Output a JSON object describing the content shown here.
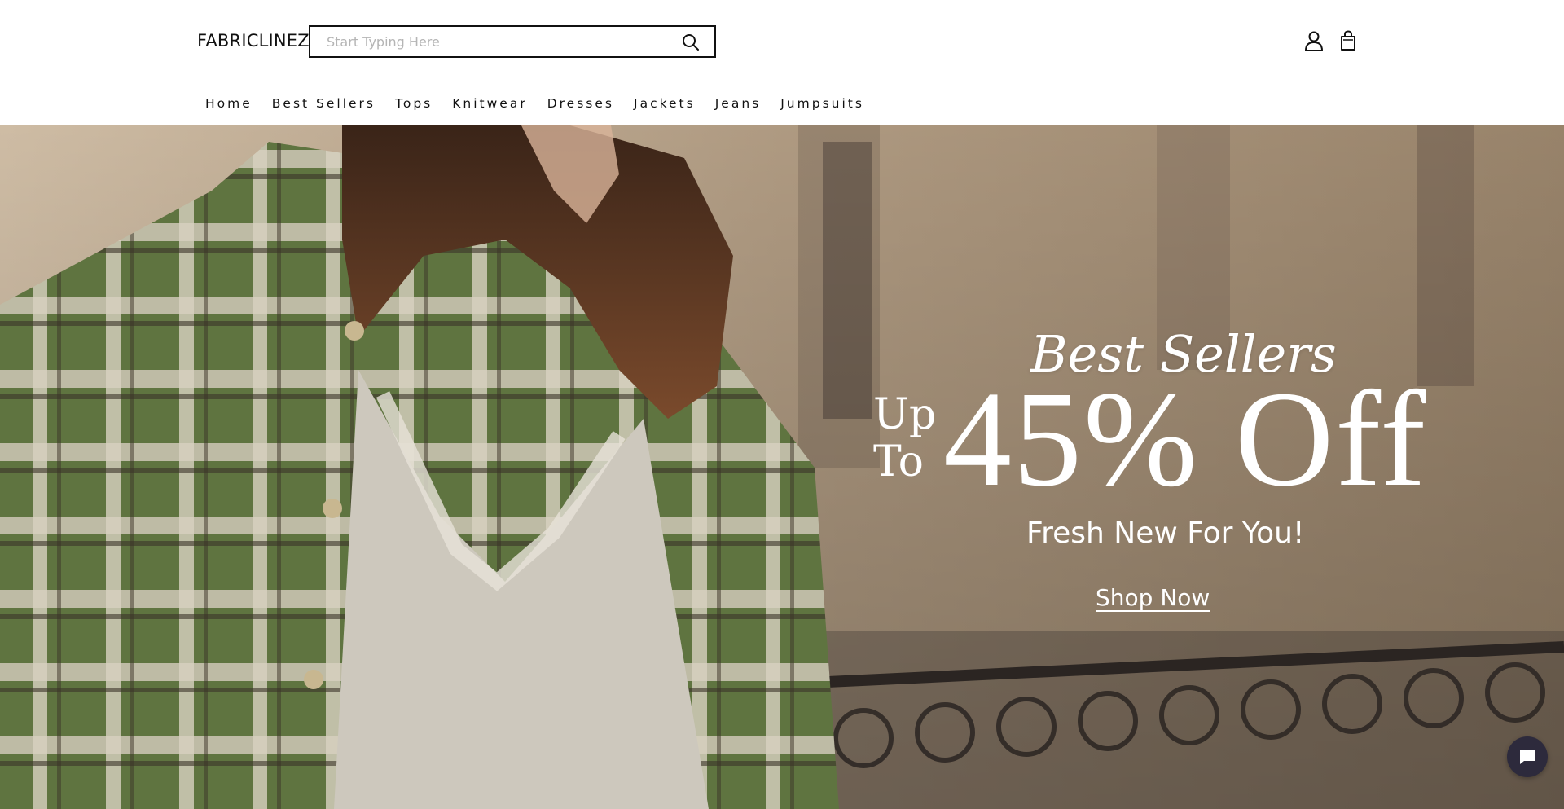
{
  "header": {
    "logo": "FABRICLINEZ",
    "search": {
      "placeholder": "Start Typing Here",
      "value": ""
    },
    "icons": [
      "search-icon",
      "user-icon",
      "shopping-bag-icon"
    ]
  },
  "nav": {
    "items": [
      "Home",
      "Best Sellers",
      "Tops",
      "Knitwear",
      "Dresses",
      "Jackets",
      "Jeans",
      "Jumpsuits"
    ]
  },
  "hero": {
    "heading": "Best Sellers",
    "up": "Up",
    "to": "To",
    "discount": "45% Off",
    "subheading": "Fresh New For You!",
    "cta": "Shop Now"
  },
  "chat": {
    "icon": "chat-bubble-icon"
  },
  "colors": {
    "text": "#111111",
    "hero_text": "#ffffff",
    "chat_bg": "#2d2a3c"
  }
}
